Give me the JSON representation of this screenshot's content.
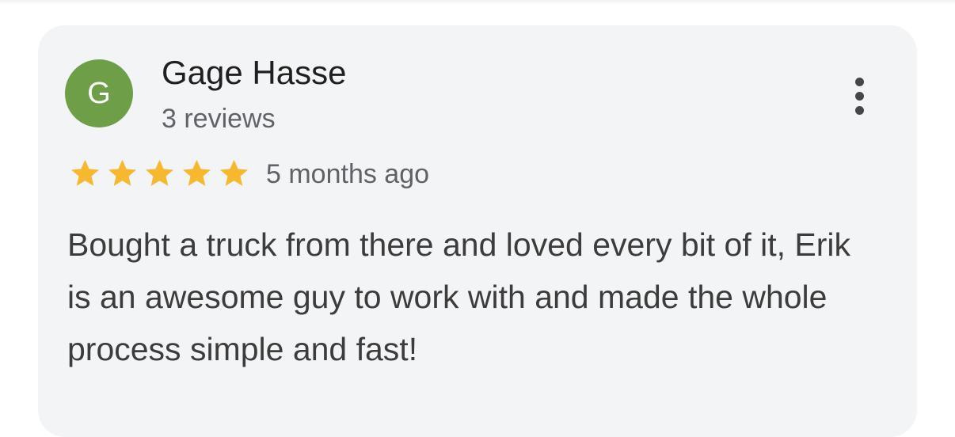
{
  "review": {
    "avatar_letter": "G",
    "avatar_color": "#6f9e48",
    "reviewer_name": "Gage Hasse",
    "review_count": "3 reviews",
    "rating": 5,
    "rating_max": 5,
    "star_color": "#f5b82e",
    "time_ago": "5 months ago",
    "text": "Bought a truck from there and loved every bit of it, Erik is an awesome guy to work with and made the whole process simple and fast!",
    "more_icon": "more-vertical-icon"
  }
}
